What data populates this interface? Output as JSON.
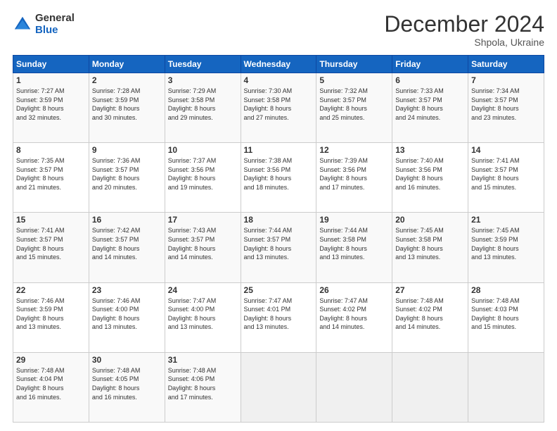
{
  "logo": {
    "general": "General",
    "blue": "Blue"
  },
  "header": {
    "month_year": "December 2024",
    "location": "Shpola, Ukraine"
  },
  "days_of_week": [
    "Sunday",
    "Monday",
    "Tuesday",
    "Wednesday",
    "Thursday",
    "Friday",
    "Saturday"
  ],
  "weeks": [
    [
      {
        "day": 1,
        "lines": [
          "Sunrise: 7:27 AM",
          "Sunset: 3:59 PM",
          "Daylight: 8 hours",
          "and 32 minutes."
        ]
      },
      {
        "day": 2,
        "lines": [
          "Sunrise: 7:28 AM",
          "Sunset: 3:59 PM",
          "Daylight: 8 hours",
          "and 30 minutes."
        ]
      },
      {
        "day": 3,
        "lines": [
          "Sunrise: 7:29 AM",
          "Sunset: 3:58 PM",
          "Daylight: 8 hours",
          "and 29 minutes."
        ]
      },
      {
        "day": 4,
        "lines": [
          "Sunrise: 7:30 AM",
          "Sunset: 3:58 PM",
          "Daylight: 8 hours",
          "and 27 minutes."
        ]
      },
      {
        "day": 5,
        "lines": [
          "Sunrise: 7:32 AM",
          "Sunset: 3:57 PM",
          "Daylight: 8 hours",
          "and 25 minutes."
        ]
      },
      {
        "day": 6,
        "lines": [
          "Sunrise: 7:33 AM",
          "Sunset: 3:57 PM",
          "Daylight: 8 hours",
          "and 24 minutes."
        ]
      },
      {
        "day": 7,
        "lines": [
          "Sunrise: 7:34 AM",
          "Sunset: 3:57 PM",
          "Daylight: 8 hours",
          "and 23 minutes."
        ]
      }
    ],
    [
      {
        "day": 8,
        "lines": [
          "Sunrise: 7:35 AM",
          "Sunset: 3:57 PM",
          "Daylight: 8 hours",
          "and 21 minutes."
        ]
      },
      {
        "day": 9,
        "lines": [
          "Sunrise: 7:36 AM",
          "Sunset: 3:57 PM",
          "Daylight: 8 hours",
          "and 20 minutes."
        ]
      },
      {
        "day": 10,
        "lines": [
          "Sunrise: 7:37 AM",
          "Sunset: 3:56 PM",
          "Daylight: 8 hours",
          "and 19 minutes."
        ]
      },
      {
        "day": 11,
        "lines": [
          "Sunrise: 7:38 AM",
          "Sunset: 3:56 PM",
          "Daylight: 8 hours",
          "and 18 minutes."
        ]
      },
      {
        "day": 12,
        "lines": [
          "Sunrise: 7:39 AM",
          "Sunset: 3:56 PM",
          "Daylight: 8 hours",
          "and 17 minutes."
        ]
      },
      {
        "day": 13,
        "lines": [
          "Sunrise: 7:40 AM",
          "Sunset: 3:56 PM",
          "Daylight: 8 hours",
          "and 16 minutes."
        ]
      },
      {
        "day": 14,
        "lines": [
          "Sunrise: 7:41 AM",
          "Sunset: 3:57 PM",
          "Daylight: 8 hours",
          "and 15 minutes."
        ]
      }
    ],
    [
      {
        "day": 15,
        "lines": [
          "Sunrise: 7:41 AM",
          "Sunset: 3:57 PM",
          "Daylight: 8 hours",
          "and 15 minutes."
        ]
      },
      {
        "day": 16,
        "lines": [
          "Sunrise: 7:42 AM",
          "Sunset: 3:57 PM",
          "Daylight: 8 hours",
          "and 14 minutes."
        ]
      },
      {
        "day": 17,
        "lines": [
          "Sunrise: 7:43 AM",
          "Sunset: 3:57 PM",
          "Daylight: 8 hours",
          "and 14 minutes."
        ]
      },
      {
        "day": 18,
        "lines": [
          "Sunrise: 7:44 AM",
          "Sunset: 3:57 PM",
          "Daylight: 8 hours",
          "and 13 minutes."
        ]
      },
      {
        "day": 19,
        "lines": [
          "Sunrise: 7:44 AM",
          "Sunset: 3:58 PM",
          "Daylight: 8 hours",
          "and 13 minutes."
        ]
      },
      {
        "day": 20,
        "lines": [
          "Sunrise: 7:45 AM",
          "Sunset: 3:58 PM",
          "Daylight: 8 hours",
          "and 13 minutes."
        ]
      },
      {
        "day": 21,
        "lines": [
          "Sunrise: 7:45 AM",
          "Sunset: 3:59 PM",
          "Daylight: 8 hours",
          "and 13 minutes."
        ]
      }
    ],
    [
      {
        "day": 22,
        "lines": [
          "Sunrise: 7:46 AM",
          "Sunset: 3:59 PM",
          "Daylight: 8 hours",
          "and 13 minutes."
        ]
      },
      {
        "day": 23,
        "lines": [
          "Sunrise: 7:46 AM",
          "Sunset: 4:00 PM",
          "Daylight: 8 hours",
          "and 13 minutes."
        ]
      },
      {
        "day": 24,
        "lines": [
          "Sunrise: 7:47 AM",
          "Sunset: 4:00 PM",
          "Daylight: 8 hours",
          "and 13 minutes."
        ]
      },
      {
        "day": 25,
        "lines": [
          "Sunrise: 7:47 AM",
          "Sunset: 4:01 PM",
          "Daylight: 8 hours",
          "and 13 minutes."
        ]
      },
      {
        "day": 26,
        "lines": [
          "Sunrise: 7:47 AM",
          "Sunset: 4:02 PM",
          "Daylight: 8 hours",
          "and 14 minutes."
        ]
      },
      {
        "day": 27,
        "lines": [
          "Sunrise: 7:48 AM",
          "Sunset: 4:02 PM",
          "Daylight: 8 hours",
          "and 14 minutes."
        ]
      },
      {
        "day": 28,
        "lines": [
          "Sunrise: 7:48 AM",
          "Sunset: 4:03 PM",
          "Daylight: 8 hours",
          "and 15 minutes."
        ]
      }
    ],
    [
      {
        "day": 29,
        "lines": [
          "Sunrise: 7:48 AM",
          "Sunset: 4:04 PM",
          "Daylight: 8 hours",
          "and 16 minutes."
        ]
      },
      {
        "day": 30,
        "lines": [
          "Sunrise: 7:48 AM",
          "Sunset: 4:05 PM",
          "Daylight: 8 hours",
          "and 16 minutes."
        ]
      },
      {
        "day": 31,
        "lines": [
          "Sunrise: 7:48 AM",
          "Sunset: 4:06 PM",
          "Daylight: 8 hours",
          "and 17 minutes."
        ]
      },
      null,
      null,
      null,
      null
    ]
  ]
}
